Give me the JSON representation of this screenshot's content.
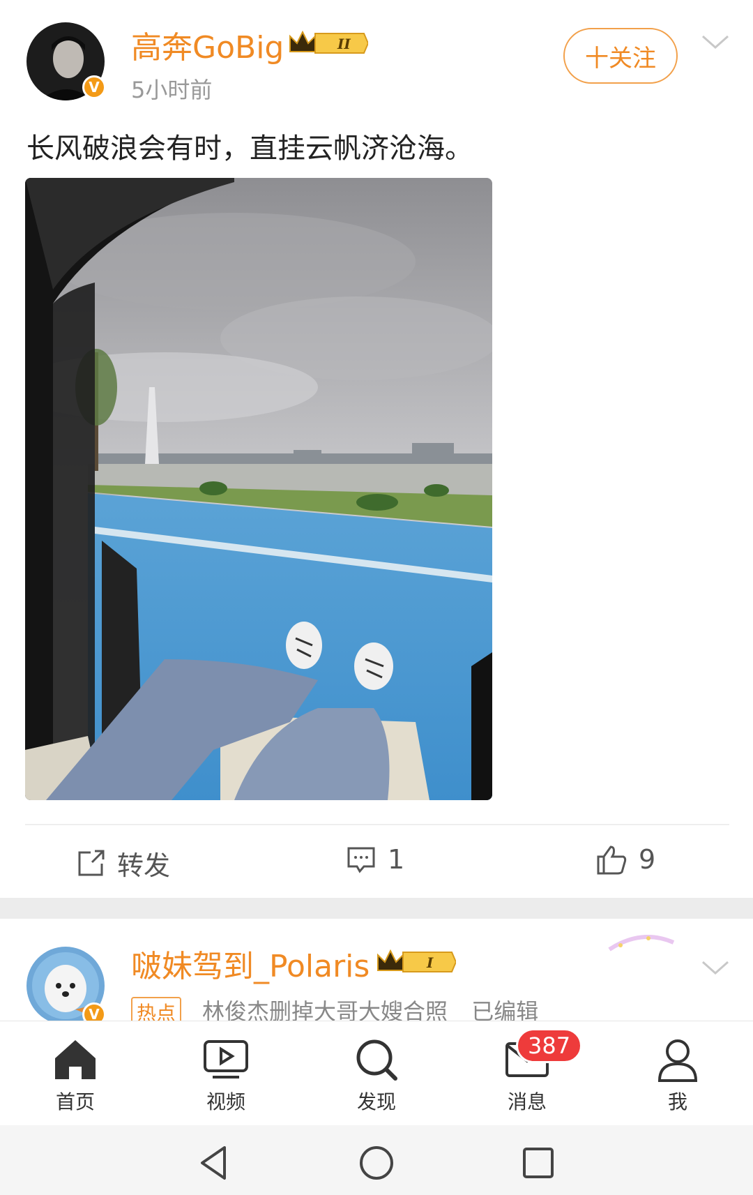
{
  "post1": {
    "username": "高奔GoBig",
    "level": "II",
    "time": "5小时前",
    "follow_label": "十关注",
    "text": "长风破浪会有时，直挂云帆济沧海。",
    "actions": {
      "repost_label": "转发",
      "comment_count": "1",
      "like_count": "9"
    }
  },
  "post2": {
    "username": "啵妹驾到_Polaris",
    "level": "I",
    "hot_tag": "热点",
    "hot_text": "林俊杰删掉大哥大嫂合照",
    "edited": "已编辑"
  },
  "tabbar": {
    "items": [
      {
        "label": "首页",
        "icon": "home-icon"
      },
      {
        "label": "视频",
        "icon": "video-icon"
      },
      {
        "label": "发现",
        "icon": "discover-icon"
      },
      {
        "label": "消息",
        "icon": "message-icon"
      },
      {
        "label": "我",
        "icon": "profile-icon"
      }
    ],
    "message_badge": "387"
  },
  "colors": {
    "accent": "#f08a24",
    "badge": "#ee3b3b"
  }
}
